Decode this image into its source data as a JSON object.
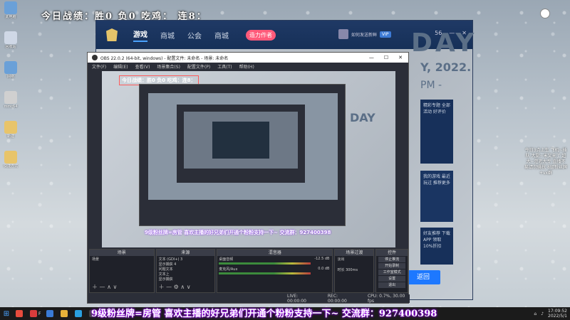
{
  "overlay": {
    "top_text": "今日战绩：胜0 负0    吃鸡：  连8：",
    "bottom_text": "9级粉丝牌=房管 喜欢主播的好兄弟们开通个粉粉支持一下~ 交流群：927400398",
    "side_note": "今日3点上车 飞机~插队 大厨~米又来了 超大~范老大专 直播不易请勿骚扰 8级粉丝牌+vx群"
  },
  "desktop_icons": [
    {
      "label": "此电脑",
      "icon": "computer-icon",
      "color": "#6aa0d8"
    },
    {
      "label": "回收站",
      "icon": "recycle-bin-icon",
      "color": "#cfd8e6"
    },
    {
      "label": "网络",
      "icon": "network-icon",
      "color": "#6aa0d8"
    },
    {
      "label": "mmc64",
      "icon": "app-icon",
      "color": "#d0d0d0"
    },
    {
      "label": "新建",
      "icon": "folder-icon",
      "color": "#e8c46a"
    },
    {
      "label": "快捷方式",
      "icon": "folder-icon",
      "color": "#e8c46a"
    }
  ],
  "client": {
    "nav": [
      "游戏",
      "商城",
      "公会",
      "商城"
    ],
    "badge": "造力作者",
    "user": "如何发送新鲜",
    "vip": "VIP",
    "count": "56",
    "day": "DAY",
    "year": "Y, 2022.",
    "pm": "PM -",
    "side1": "精彩专题 全部活动 好评价",
    "side2": "我的游戏 最近玩过 推荐更多",
    "side3": "好友推荐 下载APP 领取10%折扣",
    "return_btn": "返回"
  },
  "obs": {
    "title": "OBS 22.0.2 (64-bit, windows) - 配置文件: 未命名 - 场景: 未命名",
    "menu": [
      "文件(F)",
      "编辑(E)",
      "查看(V)",
      "场景集合(S)",
      "配置文件(P)",
      "工具(T)",
      "帮助(H)"
    ],
    "preview_overlay": "今日战绩：胜0 负0  吃鸡：连8：",
    "preview_day": "DAY",
    "ticker": "9级粉丝牌=房管 喜欢主播的好兄弟们开通个粉粉支持一下~ 交流群：927400398",
    "docks": {
      "scenes": {
        "title": "场景",
        "items": [
          "场景"
        ]
      },
      "sources": {
        "title": "来源",
        "items": [
          "文本 (GDI+) 3",
          "显示捕获 4",
          "问题文本",
          "文本上",
          "显示捕获"
        ]
      },
      "mixer": {
        "title": "混音器",
        "rows": [
          {
            "name": "桌面音频",
            "value": "-12.5 dB"
          },
          {
            "name": "麦克风/Aux",
            "value": "0.0 dB"
          }
        ]
      },
      "transitions": {
        "title": "场景过渡",
        "mode": "淡出",
        "duration_label": "时长",
        "duration": "300ms"
      },
      "controls": {
        "title": "控件",
        "buttons": [
          "停止推流",
          "开始录制",
          "工作室模式",
          "设置",
          "退出"
        ]
      }
    },
    "status": [
      "LIVE: 00:00:00",
      "REC: 00:00:00",
      "CPU: 0.7%, 30.00 fps"
    ]
  },
  "taskbar": {
    "apps": [
      {
        "label": "",
        "icon": "browser-icon",
        "color": "#e84c3d"
      },
      {
        "label": "F",
        "icon": "app-icon",
        "color": "#d93c3c"
      },
      {
        "label": "",
        "icon": "app-icon",
        "color": "#3a7bd5"
      },
      {
        "label": "",
        "icon": "chrome-icon",
        "color": "#e8b23a"
      },
      {
        "label": "",
        "icon": "qq-icon",
        "color": "#2aa0e0"
      },
      {
        "label": "",
        "icon": "obs-icon",
        "color": "#444"
      }
    ],
    "time": "17:09:52",
    "date": "2022/5/1"
  }
}
